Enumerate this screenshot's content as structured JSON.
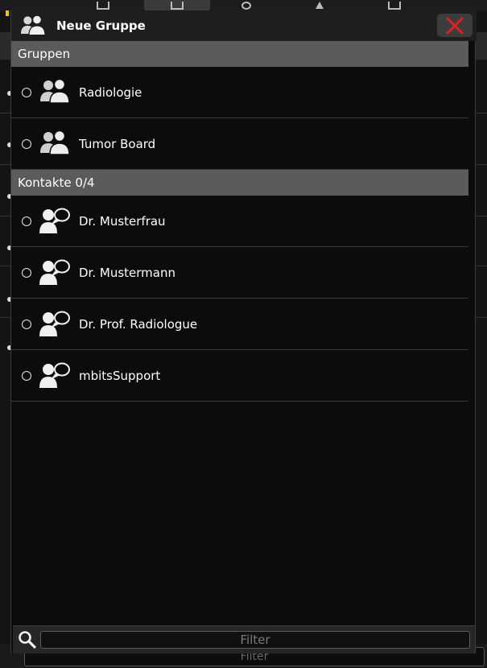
{
  "dialog": {
    "title": "Neue Gruppe",
    "header_icon": "group-icon",
    "close_icon": "close-icon"
  },
  "groups": {
    "header": "Gruppen",
    "items": [
      {
        "label": "Radiologie",
        "icon": "group-icon"
      },
      {
        "label": "Tumor Board",
        "icon": "group-icon"
      }
    ]
  },
  "contacts": {
    "header": "Kontakte 0/4",
    "items": [
      {
        "label": "Dr. Musterfrau",
        "icon": "contact-chat-icon"
      },
      {
        "label": "Dr. Mustermann",
        "icon": "contact-chat-icon"
      },
      {
        "label": "Dr. Prof. Radiologue",
        "icon": "contact-chat-icon"
      },
      {
        "label": "mbitsSupport",
        "icon": "contact-chat-icon"
      }
    ]
  },
  "filter": {
    "placeholder": "Filter",
    "icon": "search-icon"
  },
  "background": {
    "filter_placeholder": "Filter"
  },
  "colors": {
    "background": "#0c0c0c",
    "header": "#1e1e1e",
    "section_header": "#5b5b5b",
    "close_x": "#e02020",
    "accent_yellow": "#e8c61e"
  }
}
